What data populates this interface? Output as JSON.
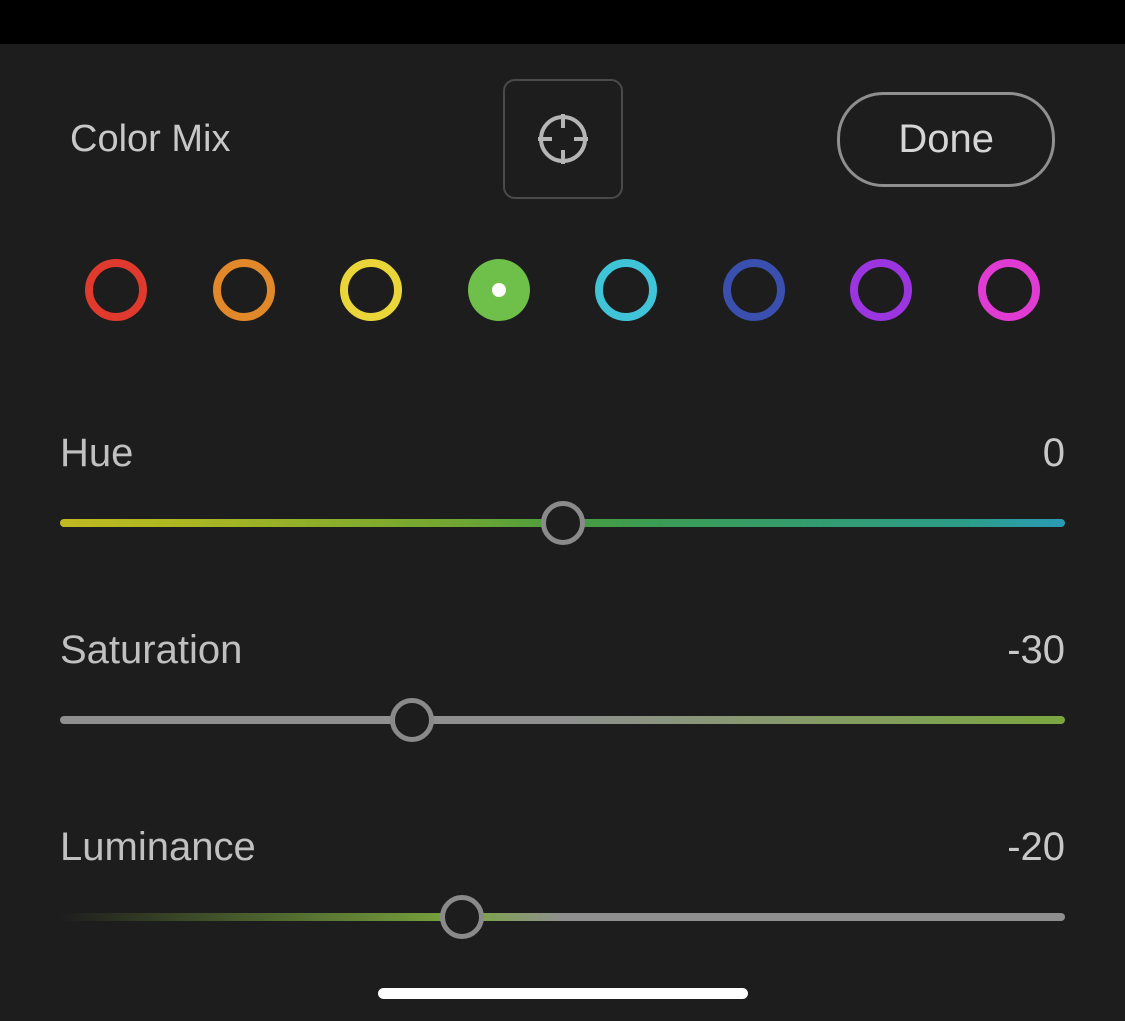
{
  "header": {
    "title": "Color Mix",
    "done_label": "Done"
  },
  "swatches": {
    "selected_index": 3,
    "items": [
      {
        "name": "red",
        "color": "#e03a2f"
      },
      {
        "name": "orange",
        "color": "#e0882a"
      },
      {
        "name": "yellow",
        "color": "#ebd63a"
      },
      {
        "name": "green",
        "color": "#6fbf4b"
      },
      {
        "name": "aqua",
        "color": "#3fc4d8"
      },
      {
        "name": "blue",
        "color": "#3a4fae"
      },
      {
        "name": "purple",
        "color": "#9b35e0"
      },
      {
        "name": "magenta",
        "color": "#e03bd2"
      }
    ]
  },
  "sliders": {
    "hue": {
      "label": "Hue",
      "value": 0,
      "min": -100,
      "max": 100
    },
    "saturation": {
      "label": "Saturation",
      "value": -30,
      "min": -100,
      "max": 100,
      "track_left_color": "#8f8f8f",
      "track_right_color": "#7aa63e"
    },
    "luminance": {
      "label": "Luminance",
      "value": -20,
      "min": -100,
      "max": 100,
      "track_left_color": "#7aa63e",
      "track_right_color": "#8f8f8f"
    }
  }
}
